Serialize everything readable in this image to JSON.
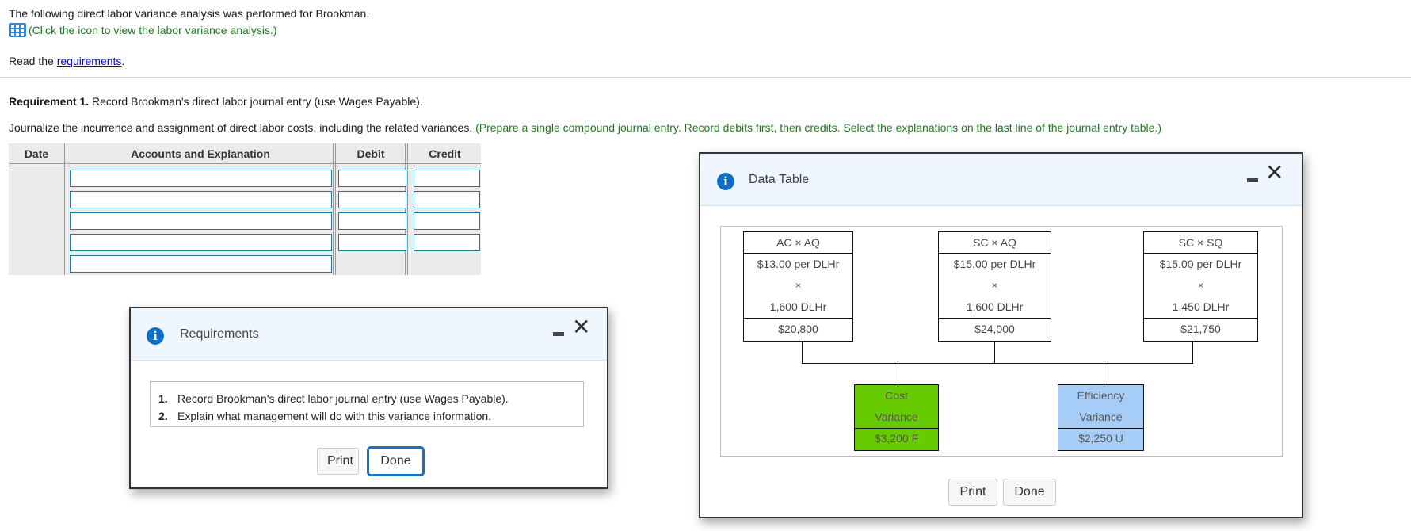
{
  "intro": {
    "line1": "The following direct labor variance analysis was performed for Brookman.",
    "icon_link": "(Click the icon to view the labor variance analysis.)",
    "read_prefix": "Read the ",
    "requirements_link": "requirements",
    "read_suffix": "."
  },
  "requirement1": {
    "label": "Requirement 1.",
    "text": " Record Brookman's direct labor journal entry (use Wages Payable)."
  },
  "instructions": {
    "text": "Journalize the incurrence and assignment of direct labor costs, including the related variances. ",
    "hint": "(Prepare a single compound journal entry. Record debits first, then credits. Select the explanations on the last line of the journal entry table.)"
  },
  "journal": {
    "headers": {
      "date": "Date",
      "accounts": "Accounts and Explanation",
      "debit": "Debit",
      "credit": "Credit"
    },
    "rows": [
      {
        "account": "",
        "debit": "",
        "credit": ""
      },
      {
        "account": "",
        "debit": "",
        "credit": ""
      },
      {
        "account": "",
        "debit": "",
        "credit": ""
      },
      {
        "account": "",
        "debit": "",
        "credit": ""
      },
      {
        "account": ""
      }
    ]
  },
  "requirements_dialog": {
    "title": "Requirements",
    "items": [
      {
        "num": "1.",
        "text": "Record Brookman's direct labor journal entry (use Wages Payable)."
      },
      {
        "num": "2.",
        "text": "Explain what management will do with this variance information."
      }
    ],
    "print_label": "Print",
    "done_label": "Done"
  },
  "data_table_dialog": {
    "title": "Data Table",
    "columns": [
      {
        "header": "AC × AQ",
        "rate": "$13.00 per DLHr",
        "times": "×",
        "qty": "1,600 DLHr",
        "total": "$20,800"
      },
      {
        "header": "SC × AQ",
        "rate": "$15.00 per DLHr",
        "times": "×",
        "qty": "1,600 DLHr",
        "total": "$24,000"
      },
      {
        "header": "SC × SQ",
        "rate": "$15.00 per DLHr",
        "times": "×",
        "qty": "1,450 DLHr",
        "total": "$21,750"
      }
    ],
    "variances": [
      {
        "line1": "Cost",
        "line2": "Variance",
        "amount": "$3,200 F",
        "color": "#66cc00"
      },
      {
        "line1": "Efficiency",
        "line2": "Variance",
        "amount": "$2,250 U",
        "color": "#a6cdf7"
      }
    ],
    "print_label": "Print",
    "done_label": "Done"
  },
  "colors": {
    "accent_green": "#1f7a1f",
    "link_blue": "#0000ee",
    "input_border": "#1b7a99",
    "info_blue": "#0f6fc6"
  }
}
